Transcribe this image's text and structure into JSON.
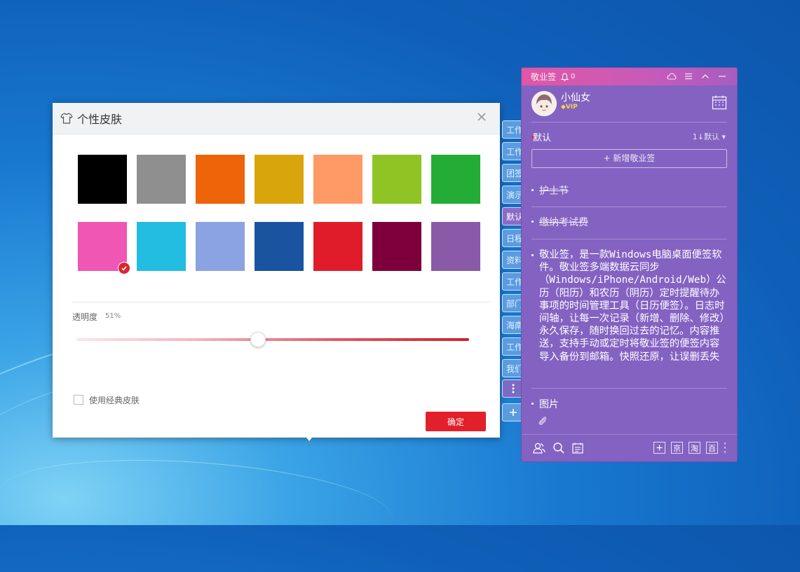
{
  "skin_dialog": {
    "title": "个性皮肤",
    "close_label": "×",
    "swatches": [
      "#000000",
      "#8f8f8f",
      "#ed6409",
      "#d8a50b",
      "#ff9966",
      "#8fc424",
      "#23ad36",
      "#f056b3",
      "#22bde0",
      "#8ba2e3",
      "#1a54a0",
      "#e11c2a",
      "#7d003c",
      "#8a5aa8"
    ],
    "selected_swatch": "#f056b3",
    "opacity_label": "透明度",
    "opacity_value": "51%",
    "opacity_level": 0.46,
    "classic_skin_label": "使用经典皮肤",
    "confirm_label": "确定"
  },
  "side_tabs": [
    "工作",
    "工作",
    "团签",
    "演示",
    "默认",
    "日程",
    "资料",
    "工作",
    "部门",
    "海南",
    "工作",
    "我们"
  ],
  "active_tab": "默认",
  "note_panel": {
    "app_title": "敬业签",
    "notification_count": "0",
    "user": {
      "name": "小仙女",
      "badge": "VIP"
    },
    "category": "默认",
    "sort_label": "1↓默认",
    "new_note_label": "+ 新增敬业签",
    "notes": [
      {
        "text": "护士节",
        "done": true
      },
      {
        "text": "缴纳考试费",
        "done": true
      },
      {
        "text": "敬业签，是一款Windows电脑桌面便签软件。敬业签多端数据云同步（Windows/iPhone/Android/Web）公历（阳历）和农历（阴历）定时提醒待办事项的时间管理工具（日历便签）。日志时间轴，让每一次记录（新增、删除、修改）永久保存，随时换回过去的记忆。内容推送，支持手动或定时将敬业签的便签内容导入备份到邮箱。快照还原，让误删丢失",
        "done": false
      },
      {
        "text": "图片",
        "done": false
      }
    ],
    "bottom_shortcuts": [
      "京",
      "淘",
      "百"
    ]
  },
  "colors": {
    "accent_red": "#e2202b",
    "panel_purple": "#8462c2",
    "titlebar_pink": "#e057a6"
  }
}
